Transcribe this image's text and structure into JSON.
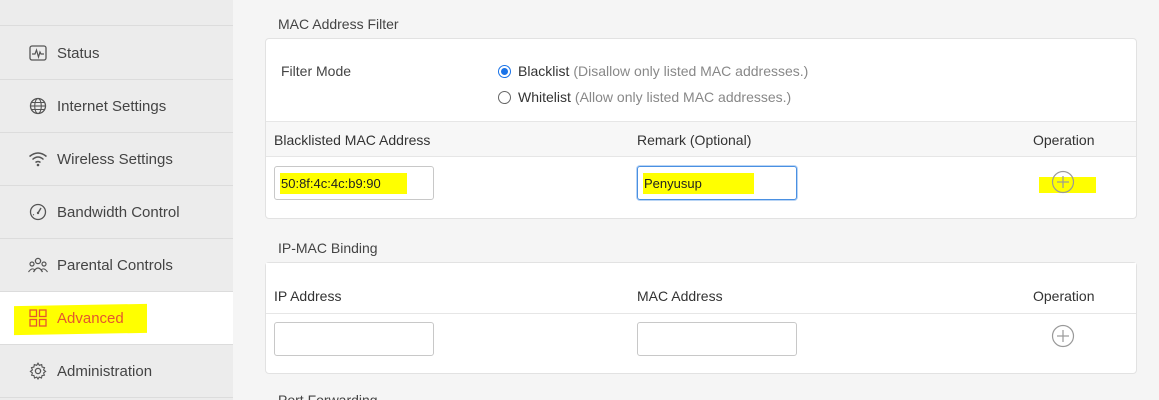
{
  "sidebar": {
    "items": [
      {
        "label": "Status",
        "icon": "status-pulse-icon"
      },
      {
        "label": "Internet Settings",
        "icon": "globe-icon"
      },
      {
        "label": "Wireless Settings",
        "icon": "wifi-icon"
      },
      {
        "label": "Bandwidth Control",
        "icon": "gauge-icon"
      },
      {
        "label": "Parental Controls",
        "icon": "family-icon"
      },
      {
        "label": "Advanced",
        "icon": "grid-icon",
        "active": true
      },
      {
        "label": "Administration",
        "icon": "gear-icon"
      }
    ],
    "active_color": "#e4572e"
  },
  "mac_filter": {
    "title": "MAC Address Filter",
    "filter_mode_label": "Filter Mode",
    "options": [
      {
        "label": "Blacklist",
        "hint": "(Disallow only listed MAC addresses.)",
        "checked": true
      },
      {
        "label": "Whitelist",
        "hint": "(Allow only listed MAC addresses.)",
        "checked": false
      }
    ],
    "columns": [
      "Blacklisted MAC Address",
      "Remark (Optional)",
      "Operation"
    ],
    "row": {
      "mac": "50:8f:4c:4c:b9:90",
      "remark": "Penyusup",
      "add_icon": "plus-circle-icon"
    }
  },
  "ip_mac_binding": {
    "title": "IP-MAC Binding",
    "columns": [
      "IP Address",
      "MAC Address",
      "Operation"
    ],
    "row": {
      "ip": "",
      "mac": "",
      "add_icon": "plus-circle-icon"
    }
  },
  "next_section_title": "Port Forwarding",
  "accent_color": "#1a73e8",
  "highlight_color": "#ffff00"
}
